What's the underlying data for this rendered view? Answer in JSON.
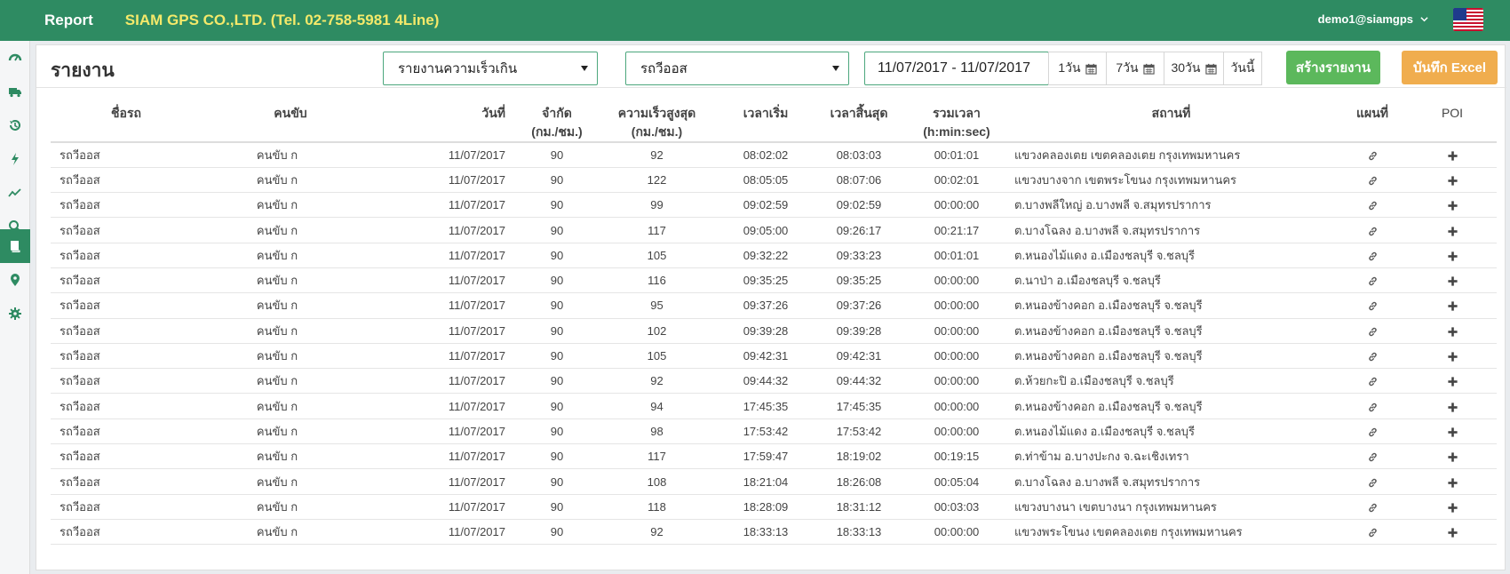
{
  "header": {
    "report_label": "Report",
    "company": "SIAM GPS CO.,LTD. (Tel. 02-758-5981 4Line)",
    "user": "demo1@siamgps",
    "bg_color": "#2e8b62",
    "company_color": "#f4e96a"
  },
  "sidebar": {
    "items": [
      {
        "icon": "dashboard-icon"
      },
      {
        "icon": "truck-icon"
      },
      {
        "icon": "history-icon"
      },
      {
        "icon": "bolt-icon"
      },
      {
        "icon": "line-chart-icon"
      },
      {
        "icon": "search-icon"
      },
      {
        "icon": "book-icon",
        "active": true
      },
      {
        "icon": "map-marker-icon"
      },
      {
        "icon": "gear-icon"
      }
    ]
  },
  "panel": {
    "title": "รายงาน",
    "report_type": "รายงานความเร็วเกิน",
    "vehicle": "รถวีออส",
    "date_range": "11/07/2017 - 11/07/2017",
    "quick": {
      "d1": "1วัน",
      "d7": "7วัน",
      "d30": "30วัน",
      "today": "วันนี้"
    },
    "create_label": "สร้างรายงาน",
    "excel_label": "บันทึก Excel"
  },
  "table": {
    "headers": {
      "vehicle": "ชื่อรถ",
      "driver": "คนขับ",
      "date": "วันที่",
      "limit": "จำกัด",
      "limit_unit": "(กม./ชม.)",
      "max_speed": "ความเร็วสูงสุด",
      "max_speed_unit": "(กม./ชม.)",
      "start": "เวลาเริ่ม",
      "end": "เวลาสิ้นสุด",
      "total": "รวมเวลา",
      "total_unit": "(h:min:sec)",
      "location": "สถานที่",
      "map": "แผนที่",
      "poi": "POI"
    },
    "rows": [
      {
        "vehicle": "รถวีออส",
        "driver": "คนขับ ก",
        "date": "11/07/2017",
        "limit": "90",
        "max": "92",
        "start": "08:02:02",
        "end": "08:03:03",
        "total": "00:01:01",
        "location": "แขวงคลองเตย เขตคลองเตย กรุงเทพมหานคร"
      },
      {
        "vehicle": "รถวีออส",
        "driver": "คนขับ ก",
        "date": "11/07/2017",
        "limit": "90",
        "max": "122",
        "start": "08:05:05",
        "end": "08:07:06",
        "total": "00:02:01",
        "location": "แขวงบางจาก เขตพระโขนง กรุงเทพมหานคร"
      },
      {
        "vehicle": "รถวีออส",
        "driver": "คนขับ ก",
        "date": "11/07/2017",
        "limit": "90",
        "max": "99",
        "start": "09:02:59",
        "end": "09:02:59",
        "total": "00:00:00",
        "location": "ต.บางพลีใหญ่ อ.บางพลี จ.สมุทรปราการ"
      },
      {
        "vehicle": "รถวีออส",
        "driver": "คนขับ ก",
        "date": "11/07/2017",
        "limit": "90",
        "max": "117",
        "start": "09:05:00",
        "end": "09:26:17",
        "total": "00:21:17",
        "location": "ต.บางโฉลง อ.บางพลี จ.สมุทรปราการ"
      },
      {
        "vehicle": "รถวีออส",
        "driver": "คนขับ ก",
        "date": "11/07/2017",
        "limit": "90",
        "max": "105",
        "start": "09:32:22",
        "end": "09:33:23",
        "total": "00:01:01",
        "location": "ต.หนองไม้แดง อ.เมืองชลบุรี จ.ชลบุรี"
      },
      {
        "vehicle": "รถวีออส",
        "driver": "คนขับ ก",
        "date": "11/07/2017",
        "limit": "90",
        "max": "116",
        "start": "09:35:25",
        "end": "09:35:25",
        "total": "00:00:00",
        "location": "ต.นาป่า อ.เมืองชลบุรี จ.ชลบุรี"
      },
      {
        "vehicle": "รถวีออส",
        "driver": "คนขับ ก",
        "date": "11/07/2017",
        "limit": "90",
        "max": "95",
        "start": "09:37:26",
        "end": "09:37:26",
        "total": "00:00:00",
        "location": "ต.หนองข้างคอก อ.เมืองชลบุรี จ.ชลบุรี"
      },
      {
        "vehicle": "รถวีออส",
        "driver": "คนขับ ก",
        "date": "11/07/2017",
        "limit": "90",
        "max": "102",
        "start": "09:39:28",
        "end": "09:39:28",
        "total": "00:00:00",
        "location": "ต.หนองข้างคอก อ.เมืองชลบุรี จ.ชลบุรี"
      },
      {
        "vehicle": "รถวีออส",
        "driver": "คนขับ ก",
        "date": "11/07/2017",
        "limit": "90",
        "max": "105",
        "start": "09:42:31",
        "end": "09:42:31",
        "total": "00:00:00",
        "location": "ต.หนองข้างคอก อ.เมืองชลบุรี จ.ชลบุรี"
      },
      {
        "vehicle": "รถวีออส",
        "driver": "คนขับ ก",
        "date": "11/07/2017",
        "limit": "90",
        "max": "92",
        "start": "09:44:32",
        "end": "09:44:32",
        "total": "00:00:00",
        "location": "ต.ห้วยกะปิ อ.เมืองชลบุรี จ.ชลบุรี"
      },
      {
        "vehicle": "รถวีออส",
        "driver": "คนขับ ก",
        "date": "11/07/2017",
        "limit": "90",
        "max": "94",
        "start": "17:45:35",
        "end": "17:45:35",
        "total": "00:00:00",
        "location": "ต.หนองข้างคอก อ.เมืองชลบุรี จ.ชลบุรี"
      },
      {
        "vehicle": "รถวีออส",
        "driver": "คนขับ ก",
        "date": "11/07/2017",
        "limit": "90",
        "max": "98",
        "start": "17:53:42",
        "end": "17:53:42",
        "total": "00:00:00",
        "location": "ต.หนองไม้แดง อ.เมืองชลบุรี จ.ชลบุรี"
      },
      {
        "vehicle": "รถวีออส",
        "driver": "คนขับ ก",
        "date": "11/07/2017",
        "limit": "90",
        "max": "117",
        "start": "17:59:47",
        "end": "18:19:02",
        "total": "00:19:15",
        "location": "ต.ท่าข้าม อ.บางปะกง จ.ฉะเชิงเทรา"
      },
      {
        "vehicle": "รถวีออส",
        "driver": "คนขับ ก",
        "date": "11/07/2017",
        "limit": "90",
        "max": "108",
        "start": "18:21:04",
        "end": "18:26:08",
        "total": "00:05:04",
        "location": "ต.บางโฉลง อ.บางพลี จ.สมุทรปราการ"
      },
      {
        "vehicle": "รถวีออส",
        "driver": "คนขับ ก",
        "date": "11/07/2017",
        "limit": "90",
        "max": "118",
        "start": "18:28:09",
        "end": "18:31:12",
        "total": "00:03:03",
        "location": "แขวงบางนา เขตบางนา กรุงเทพมหานคร"
      },
      {
        "vehicle": "รถวีออส",
        "driver": "คนขับ ก",
        "date": "11/07/2017",
        "limit": "90",
        "max": "92",
        "start": "18:33:13",
        "end": "18:33:13",
        "total": "00:00:00",
        "location": "แขวงพระโขนง เขตคลองเตย กรุงเทพมหานคร"
      }
    ]
  }
}
